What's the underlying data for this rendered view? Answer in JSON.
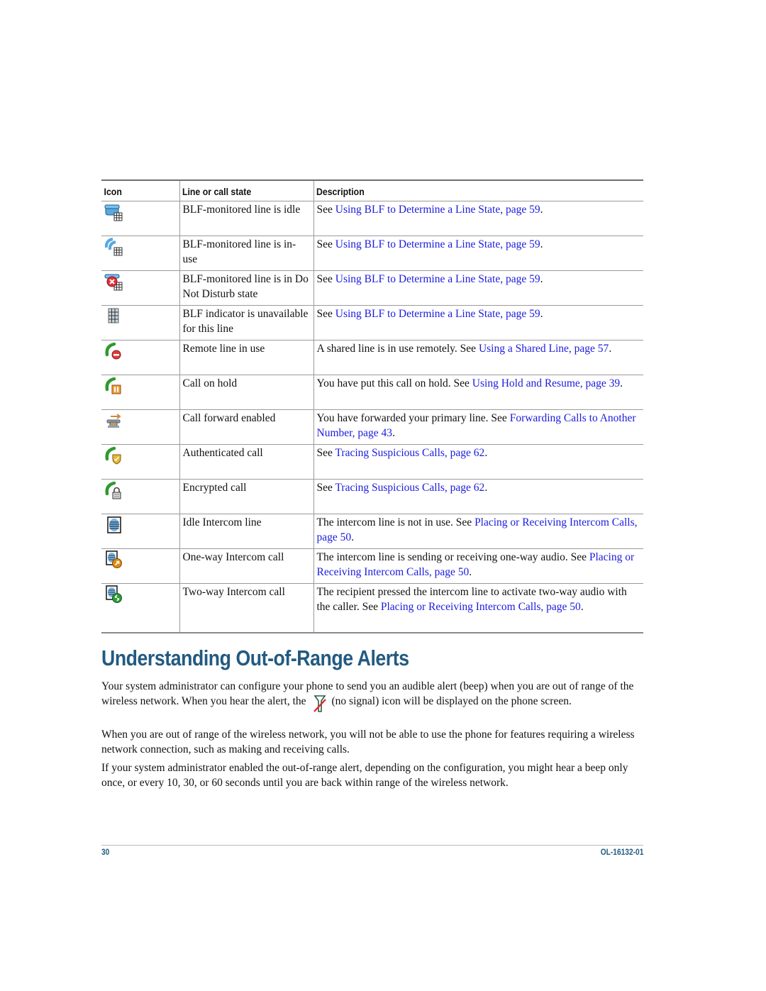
{
  "table": {
    "headers": [
      "Icon",
      "Line or call state",
      "Description"
    ],
    "rows": [
      {
        "icon": "blf-idle-phone-icon",
        "state": "BLF-monitored line is idle",
        "desc_prefix": "See ",
        "link": "Using BLF to Determine a Line State, page 59",
        "desc_suffix": "."
      },
      {
        "icon": "blf-in-use-phone-icon",
        "state": "BLF-monitored line is in-use",
        "desc_prefix": "See ",
        "link": "Using BLF to Determine a Line State, page 59",
        "desc_suffix": "."
      },
      {
        "icon": "blf-dnd-phone-icon",
        "state": "BLF-monitored line is in Do Not Disturb state",
        "desc_prefix": "See ",
        "link": "Using BLF to Determine a Line State, page 59",
        "desc_suffix": "."
      },
      {
        "icon": "blf-unavailable-grid-icon",
        "state": "BLF indicator is unavailable for this line",
        "desc_prefix": "See ",
        "link": "Using BLF to Determine a Line State, page 59",
        "desc_suffix": "."
      },
      {
        "icon": "remote-line-in-use-icon",
        "state": "Remote line in use",
        "desc_prefix": "A shared line is in use remotely. See ",
        "link": "Using a Shared Line, page 57",
        "desc_suffix": "."
      },
      {
        "icon": "call-on-hold-icon",
        "state": "Call on hold",
        "desc_prefix": "You have put this call on hold. See ",
        "link": "Using Hold and Resume, page 39",
        "desc_suffix": "."
      },
      {
        "icon": "call-forward-icon",
        "state": "Call forward enabled",
        "desc_prefix": "You have forwarded your primary line. See ",
        "link": "Forwarding Calls to Another Number, page 43",
        "desc_suffix": "."
      },
      {
        "icon": "authenticated-call-shield-icon",
        "state": "Authenticated call",
        "desc_prefix": "See ",
        "link": "Tracing Suspicious Calls, page 62",
        "desc_suffix": "."
      },
      {
        "icon": "encrypted-call-lock-icon",
        "state": "Encrypted call",
        "desc_prefix": "See ",
        "link": "Tracing Suspicious Calls, page 62",
        "desc_suffix": "."
      },
      {
        "icon": "idle-intercom-icon",
        "state": "Idle Intercom line",
        "desc_prefix": "The intercom line is not in use. See ",
        "link": "Placing or Receiving Intercom Calls, page 50",
        "desc_suffix": "."
      },
      {
        "icon": "one-way-intercom-icon",
        "state": "One-way Intercom call",
        "desc_prefix": "The intercom line is sending or receiving one-way audio. See ",
        "link": "Placing or Receiving Intercom Calls, page 50",
        "desc_suffix": "."
      },
      {
        "icon": "two-way-intercom-icon",
        "state": "Two-way Intercom call",
        "desc_prefix": "The recipient pressed the intercom line to activate two-way audio with the caller. See ",
        "link": "Placing or Receiving Intercom Calls, page 50",
        "desc_suffix": "."
      }
    ]
  },
  "section": {
    "title": "Understanding Out-of-Range Alerts",
    "p1_before": "Your system administrator can configure your phone to send you an audible alert (beep) when you are out of range of the wireless network. When you hear the alert, the",
    "p1_icon": "no-signal-icon",
    "p1_after": "(no signal) icon will be displayed on the phone screen.",
    "p2": "When you are out of range of the wireless network, you will not be able to use the phone for features requiring a wireless network connection, such as making and receiving calls.",
    "p3": "If your system administrator enabled the out-of-range alert, depending on the configuration, you might hear a beep only once, or every 10, 30, or 60 seconds until you are back within range of the wireless network."
  },
  "footer": {
    "page_number": "30",
    "doc_id": "OL-16132-01"
  },
  "colors": {
    "heading": "#235a80",
    "link": "#1c1cdc"
  }
}
